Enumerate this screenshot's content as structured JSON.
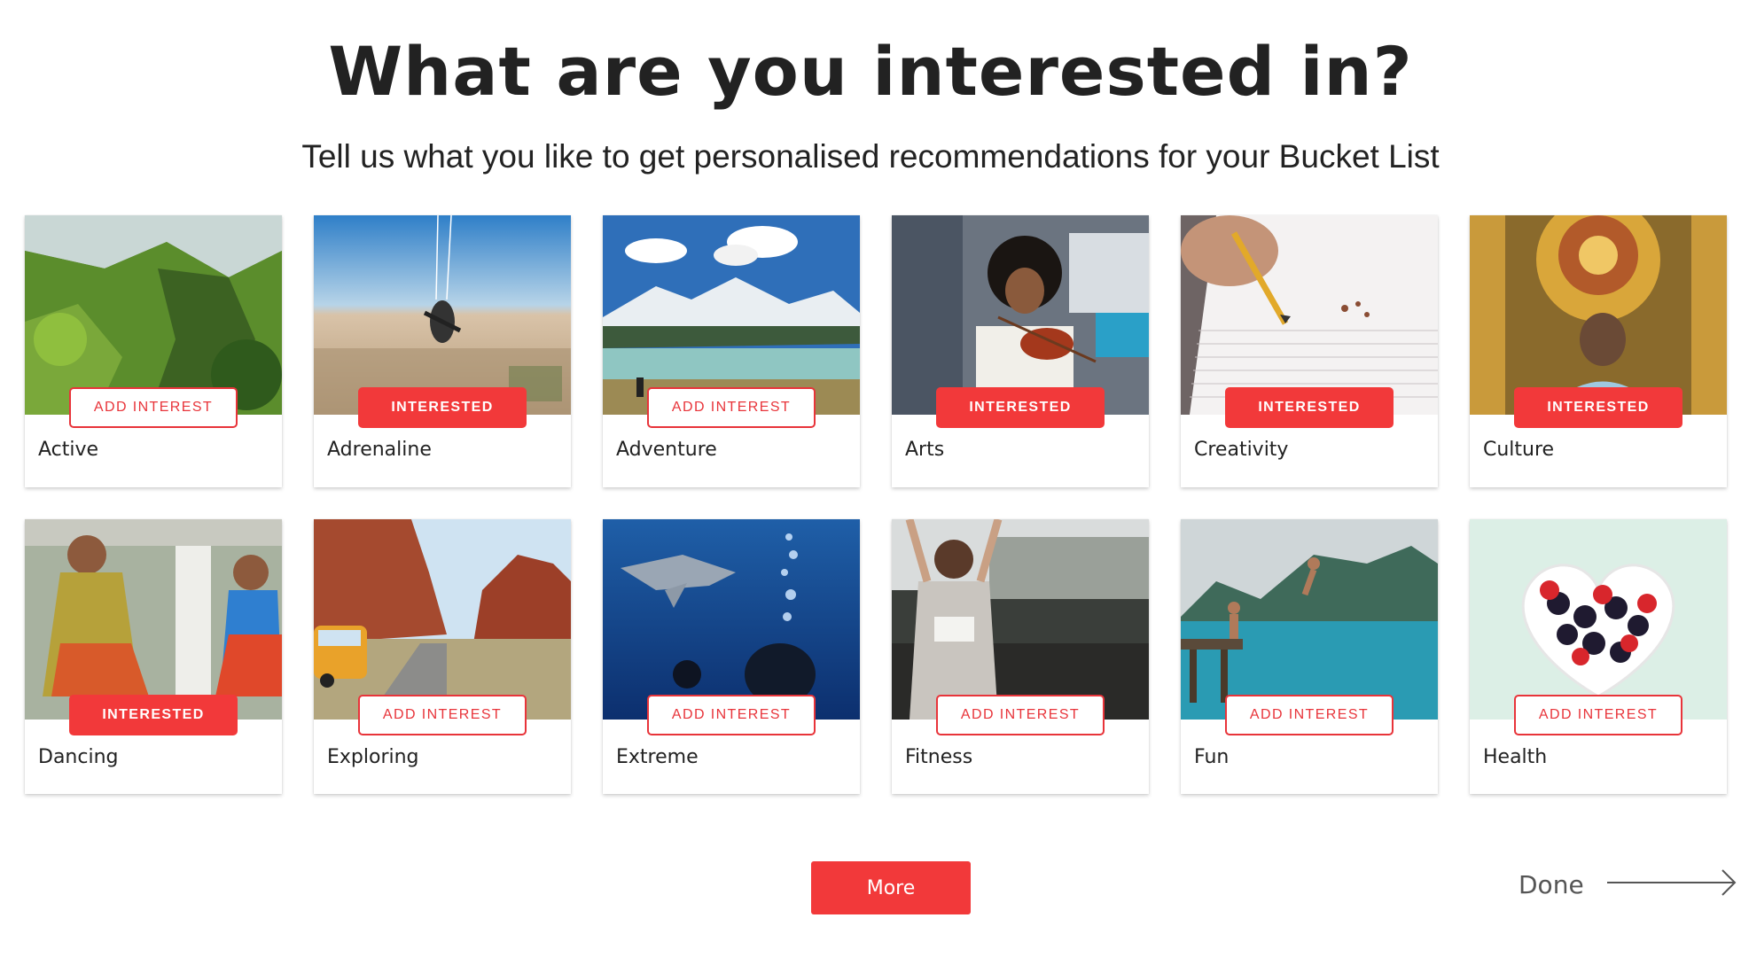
{
  "header": {
    "title": "What are you interested in?",
    "subtitle": "Tell us what you like to get personalised recommendations for your Bucket List"
  },
  "interests": [
    {
      "label": "Active",
      "button": "ADD INTEREST",
      "selected": false,
      "image": "green-cliffs-photo"
    },
    {
      "label": "Adrenaline",
      "button": "INTERESTED",
      "selected": true,
      "image": "skydiving-photo"
    },
    {
      "label": "Adventure",
      "button": "ADD INTEREST",
      "selected": false,
      "image": "snowy-mountain-lake-photo"
    },
    {
      "label": "Arts",
      "button": "INTERESTED",
      "selected": true,
      "image": "violinist-photo"
    },
    {
      "label": "Creativity",
      "button": "INTERESTED",
      "selected": true,
      "image": "pencil-notebook-photo"
    },
    {
      "label": "Culture",
      "button": "INTERESTED",
      "selected": true,
      "image": "ornate-ceiling-photo"
    },
    {
      "label": "Dancing",
      "button": "INTERESTED",
      "selected": true,
      "image": "dancers-photo"
    },
    {
      "label": "Exploring",
      "button": "ADD INTEREST",
      "selected": false,
      "image": "canyon-road-van-photo"
    },
    {
      "label": "Extreme",
      "button": "ADD INTEREST",
      "selected": false,
      "image": "shark-diver-photo"
    },
    {
      "label": "Fitness",
      "button": "ADD INTEREST",
      "selected": false,
      "image": "woman-stretching-photo"
    },
    {
      "label": "Fun",
      "button": "ADD INTEREST",
      "selected": false,
      "image": "jumping-pier-photo"
    },
    {
      "label": "Health",
      "button": "ADD INTEREST",
      "selected": false,
      "image": "heart-bowl-berries-photo"
    }
  ],
  "actions": {
    "more_label": "More",
    "done_label": "Done"
  },
  "colors": {
    "accent": "#f2393a",
    "text": "#222222",
    "muted": "#555555"
  },
  "icons": {
    "done": "arrow-right-icon"
  }
}
